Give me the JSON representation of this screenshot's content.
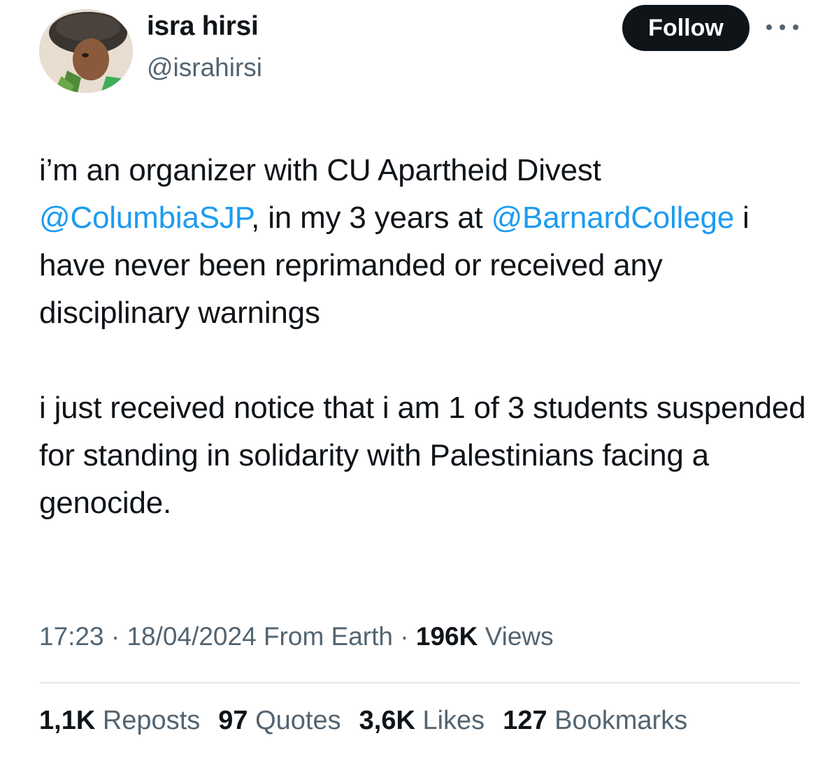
{
  "author": {
    "name": "isra hirsi",
    "handle": "@israhirsi"
  },
  "header": {
    "follow_label": "Follow"
  },
  "tweet": {
    "para1": {
      "t1": "i’m an organizer with CU Apartheid Divest ",
      "mention1": "@ColumbiaSJP",
      "t2": ", in my 3 years at ",
      "mention2": "@BarnardCollege",
      "t3": " i have never been reprimanded or received any disciplinary warnings"
    },
    "para2": "i just received notice that i am 1 of 3 students suspended for standing in solidarity with Palestinians facing a genocide."
  },
  "meta": {
    "time": "17:23",
    "date": "18/04/2024",
    "source": "From Earth",
    "separator": "·",
    "views_count": "196K",
    "views_label": "Views"
  },
  "stats": {
    "reposts": {
      "count": "1,1K",
      "label": "Reposts"
    },
    "quotes": {
      "count": "97",
      "label": "Quotes"
    },
    "likes": {
      "count": "3,6K",
      "label": "Likes"
    },
    "bookmarks": {
      "count": "127",
      "label": "Bookmarks"
    }
  },
  "colors": {
    "link": "#1d9bf0",
    "text": "#0f1419",
    "secondary": "#536471",
    "button_bg": "#0f1419"
  },
  "icons": {
    "more": "more-horizontal-icon"
  }
}
